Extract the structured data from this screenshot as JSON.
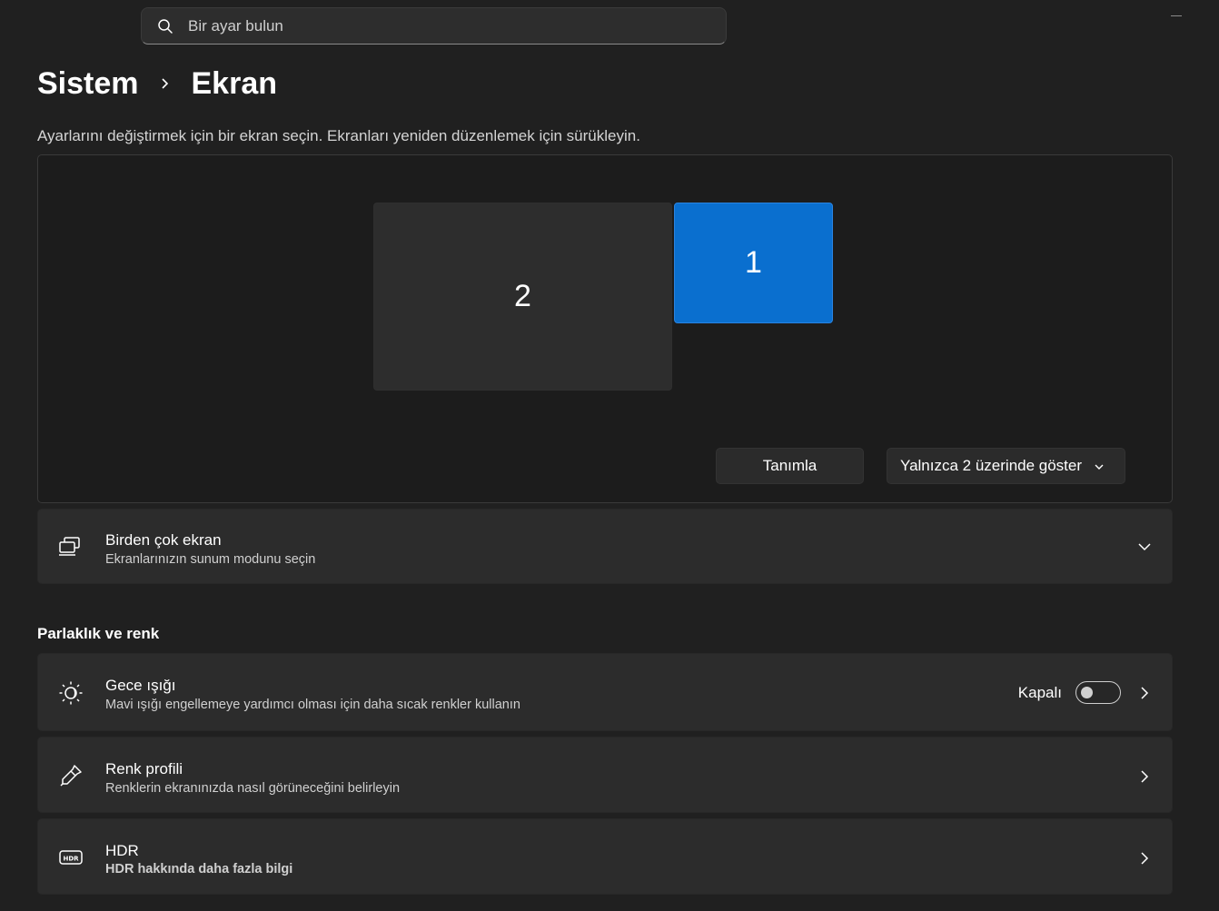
{
  "search": {
    "placeholder": "Bir ayar bulun"
  },
  "breadcrumb": {
    "parent": "Sistem",
    "current": "Ekran"
  },
  "hint": "Ayarlarını değiştirmek için bir ekran seçin. Ekranları yeniden düzenlemek için sürükleyin.",
  "arrangement": {
    "monitors": [
      {
        "label": "2",
        "selected": false
      },
      {
        "label": "1",
        "selected": true
      }
    ],
    "identify_label": "Tanımla",
    "mode_dropdown": "Yalnızca 2 üzerinde göster"
  },
  "multi_display": {
    "title": "Birden çok ekran",
    "subtitle": "Ekranlarınızın sunum modunu seçin"
  },
  "brightness_section": {
    "title": "Parlaklık ve renk"
  },
  "night_light": {
    "title": "Gece ışığı",
    "subtitle": "Mavi ışığı engellemeye yardımcı olması için daha sıcak renkler kullanın",
    "state_label": "Kapalı",
    "enabled": false
  },
  "color_profile": {
    "title": "Renk profili",
    "subtitle": "Renklerin ekranınızda nasıl görüneceğini belirleyin"
  },
  "hdr": {
    "title": "HDR",
    "link": "HDR hakkında daha fazla bilgi"
  },
  "colors": {
    "background": "#202020",
    "card": "#2c2c2c",
    "accent": "#0a6fcf",
    "link": "#8fd0f5"
  }
}
